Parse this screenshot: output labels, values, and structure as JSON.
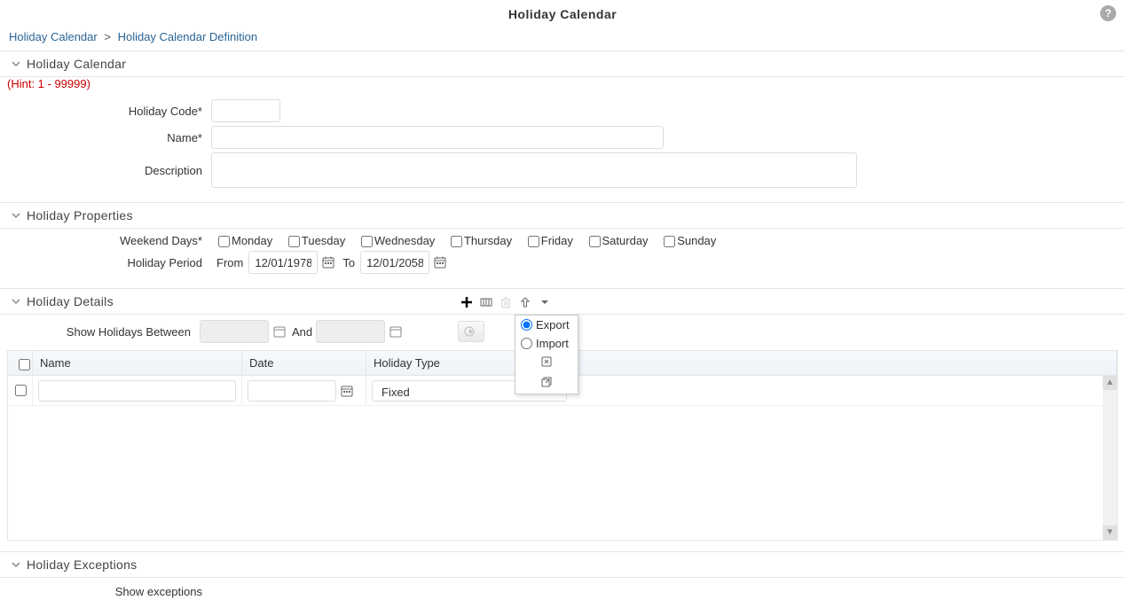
{
  "header": {
    "title": "Holiday Calendar",
    "help": "?"
  },
  "breadcrumb": {
    "root": "Holiday Calendar",
    "sep": ">",
    "current": "Holiday Calendar Definition"
  },
  "section_calendar": {
    "title": "Holiday Calendar",
    "hint": "(Hint: 1 - 99999)",
    "labels": {
      "code": "Holiday Code*",
      "name": "Name*",
      "description": "Description"
    },
    "values": {
      "code": "",
      "name": "",
      "description": ""
    }
  },
  "section_properties": {
    "title": "Holiday Properties",
    "weekend_label": "Weekend Days*",
    "days": {
      "mon": "Monday",
      "tue": "Tuesday",
      "wed": "Wednesday",
      "thu": "Thursday",
      "fri": "Friday",
      "sat": "Saturday",
      "sun": "Sunday"
    },
    "period": {
      "label": "Holiday Period",
      "from_label": "From",
      "from": "12/01/1978",
      "to_label": "To",
      "to": "12/01/2058"
    }
  },
  "section_details": {
    "title": "Holiday Details",
    "dropdown": {
      "export": "Export",
      "import": "Import"
    },
    "filter": {
      "label": "Show Holidays Between",
      "from": "",
      "and": "And",
      "to": ""
    },
    "columns": {
      "name": "Name",
      "date": "Date",
      "type": "Holiday Type"
    },
    "row1": {
      "name": "",
      "date": "",
      "type": "Fixed"
    }
  },
  "section_exceptions": {
    "title": "Holiday Exceptions",
    "show_label": "Show exceptions"
  }
}
